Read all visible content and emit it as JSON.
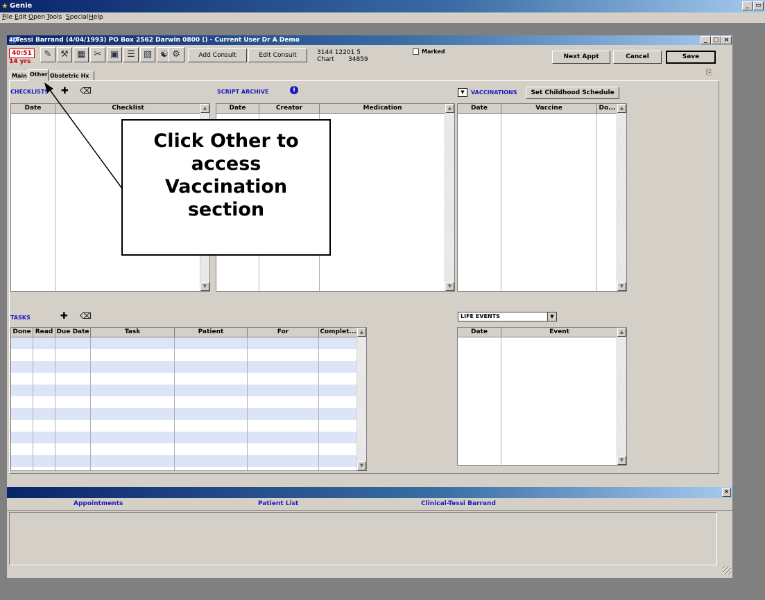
{
  "app": {
    "title": "Genie",
    "logo_icon": "genie-icon"
  },
  "menu": [
    {
      "label": "File",
      "u": "F",
      "rest": "ile"
    },
    {
      "label": "Edit",
      "u": "E",
      "rest": "dit"
    },
    {
      "label": "Open",
      "u": "O",
      "rest": "pen"
    },
    {
      "label": "Tools",
      "u": "T",
      "rest": "ools"
    },
    {
      "label": "Special",
      "u": "S",
      "rest": "pecial"
    },
    {
      "label": "Help",
      "u": "H",
      "rest": "elp"
    }
  ],
  "window": {
    "title": "Tessi Barrand (4/04/1993) PO Box 2562 Darwin 0800 () - Current User Dr A Demo",
    "icon_text": "4D"
  },
  "patient": {
    "timer": "40:51",
    "age": "14 yrs",
    "phone": "3144 12201 5",
    "chart_label": "Chart",
    "chart_number": "34859"
  },
  "toolbar": {
    "add_consult": "Add Consult",
    "edit_consult": "Edit Consult",
    "marked": "Marked",
    "next_appt": "Next Appt",
    "cancel": "Cancel",
    "save": "Save"
  },
  "tabs": [
    {
      "label": "Main"
    },
    {
      "label": "Other"
    },
    {
      "label": "Obstetric Hx"
    }
  ],
  "checklists": {
    "title": "CHECKLISTS",
    "columns": [
      "Date",
      "Checklist"
    ]
  },
  "script_archive": {
    "title": "SCRIPT ARCHIVE",
    "columns": [
      "Date",
      "Creator",
      "Medication"
    ]
  },
  "vaccinations": {
    "title": "VACCINATIONS",
    "schedule_button": "Set Childhood Schedule",
    "columns": [
      "Date",
      "Vaccine",
      "Do..."
    ]
  },
  "tasks": {
    "title": "TASKS",
    "columns": [
      "Done",
      "Read",
      "Due Date",
      "Task",
      "Patient",
      "For",
      "Complet..."
    ]
  },
  "life_events": {
    "selected": "LIFE EVENTS",
    "columns": [
      "Date",
      "Event"
    ]
  },
  "callout": {
    "line1": "Click Other to",
    "line2": "access",
    "line3": "Vaccination",
    "line4": "section"
  },
  "bottom_nav": {
    "appointments": "Appointments",
    "patient_list": "Patient List",
    "clinical": "Clinical-Tessi Barrand"
  },
  "colors": {
    "section_blue": "#1a1abf",
    "timer_red": "#cc0000",
    "row_stripe": "#dce4f8",
    "chrome": "#d4d0c8"
  }
}
